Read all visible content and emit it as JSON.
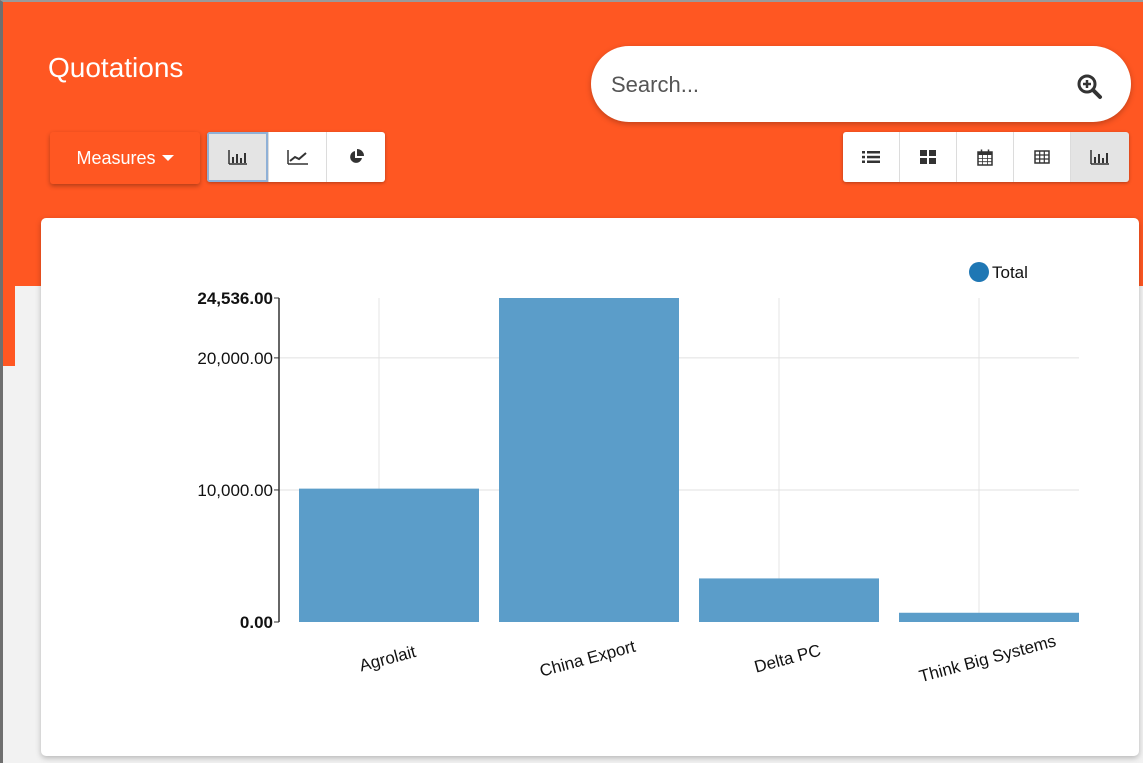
{
  "header": {
    "title": "Quotations",
    "search_placeholder": "Search...",
    "measures_label": "Measures"
  },
  "chart_modes": [
    {
      "name": "bar-chart-mode",
      "icon": "bar-chart-icon",
      "active": true
    },
    {
      "name": "line-chart-mode",
      "icon": "line-chart-icon",
      "active": false
    },
    {
      "name": "pie-chart-mode",
      "icon": "pie-chart-icon",
      "active": false
    }
  ],
  "view_switcher": [
    {
      "name": "list-view",
      "icon": "list-icon",
      "active": false
    },
    {
      "name": "kanban-view",
      "icon": "kanban-icon",
      "active": false
    },
    {
      "name": "calendar-view",
      "icon": "calendar-icon",
      "active": false
    },
    {
      "name": "pivot-view",
      "icon": "table-icon",
      "active": false
    },
    {
      "name": "graph-view",
      "icon": "bar-chart-icon",
      "active": true
    }
  ],
  "colors": {
    "brand": "#ff5722",
    "bar": "#5b9dc9",
    "legend_dot": "#1f77b4"
  },
  "chart_data": {
    "type": "bar",
    "categories": [
      "Agrolait",
      "China Export",
      "Delta PC",
      "Think Big Systems"
    ],
    "series": [
      {
        "name": "Total",
        "values": [
          10100,
          24536,
          3300,
          700
        ]
      }
    ],
    "ylim": [
      0,
      24536
    ],
    "y_ticks": [
      {
        "value": 0,
        "label": "0.00",
        "bold": true
      },
      {
        "value": 10000,
        "label": "10,000.00",
        "bold": false
      },
      {
        "value": 20000,
        "label": "20,000.00",
        "bold": false
      },
      {
        "value": 24536,
        "label": "24,536.00",
        "bold": true
      }
    ],
    "grid": true,
    "legend": "top-right"
  }
}
